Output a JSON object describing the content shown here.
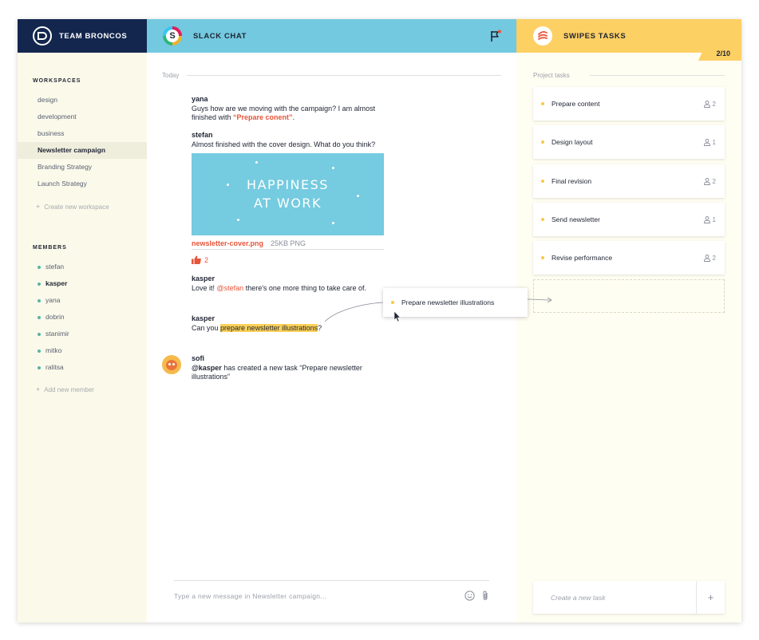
{
  "team": {
    "name": "TEAM BRONCOS"
  },
  "sidebar": {
    "workspaces_label": "WORKSPACES",
    "workspaces": [
      {
        "label": "design",
        "active": false
      },
      {
        "label": "development",
        "active": false
      },
      {
        "label": "business",
        "active": false
      },
      {
        "label": "Newsletter campaign",
        "active": true
      },
      {
        "label": "Branding Strategy",
        "active": false
      },
      {
        "label": "Launch Strategy",
        "active": false
      }
    ],
    "create_workspace": "Create new workspace",
    "members_label": "MEMBERS",
    "members": [
      {
        "label": "stefan",
        "active": false
      },
      {
        "label": "kasper",
        "active": true
      },
      {
        "label": "yana",
        "active": false
      },
      {
        "label": "dobrin",
        "active": false
      },
      {
        "label": "stanimir",
        "active": false
      },
      {
        "label": "mitko",
        "active": false
      },
      {
        "label": "ralitsa",
        "active": false
      }
    ],
    "add_member": "Add new member"
  },
  "chat": {
    "title": "SLACK CHAT",
    "logo_letter": "S",
    "day_label": "Today",
    "messages": {
      "m1": {
        "author": "yana",
        "text_a": "Guys how are we moving with the campaign? I am almost finished with ",
        "link": "“Prepare conent”",
        "text_b": "."
      },
      "m2": {
        "author": "stefan",
        "text": "Almost finished with the cover design. What do you think?"
      },
      "m3": {
        "author": "kasper",
        "text_a": "Love it! ",
        "mention": "@stefan",
        "text_b": " there's one more thing to take care of."
      },
      "m4": {
        "author": "kasper",
        "text_a": "Can you ",
        "highlight": "prepare newsletter illustrations",
        "text_b": "?"
      },
      "m5": {
        "author": "sofi",
        "mention": "@kasper",
        "text": " has created a new task “Prepare newsletter illustrations”"
      }
    },
    "attachment": {
      "image_line1": "HAPPINESS",
      "image_line2": "AT WORK",
      "filename": "newsletter-cover.png",
      "meta": "25KB PNG",
      "likes": "2"
    },
    "composer_placeholder": "Type a new message in Newsletter campaign..."
  },
  "tasks": {
    "title": "SWIPES TASKS",
    "counter": "2/10",
    "section_label": "Project tasks",
    "items": [
      {
        "label": "Prepare content",
        "assignees": "2"
      },
      {
        "label": "Design layout",
        "assignees": "1"
      },
      {
        "label": "Final revision",
        "assignees": "2"
      },
      {
        "label": "Send newsletter",
        "assignees": "1"
      },
      {
        "label": "Revise performance",
        "assignees": "2"
      }
    ],
    "dragging_task": "Prepare newsletter illustrations",
    "new_task_placeholder": "Create a new task",
    "add_symbol": "+"
  },
  "icons": {
    "team_logo": "team-broncos-logo-icon",
    "flag": "flag-icon",
    "like": "thumbs-up-icon",
    "emoji": "smiley-icon",
    "attach": "paperclip-icon",
    "assignee": "person-icon",
    "cursor": "mouse-pointer-icon"
  },
  "colors": {
    "navy": "#13264d",
    "slack_blue": "#73c9df",
    "swipes_yellow": "#fdd064",
    "accent_red": "#e7553a",
    "highlight": "#fcd158",
    "member_dot": "#5ab3a6"
  }
}
